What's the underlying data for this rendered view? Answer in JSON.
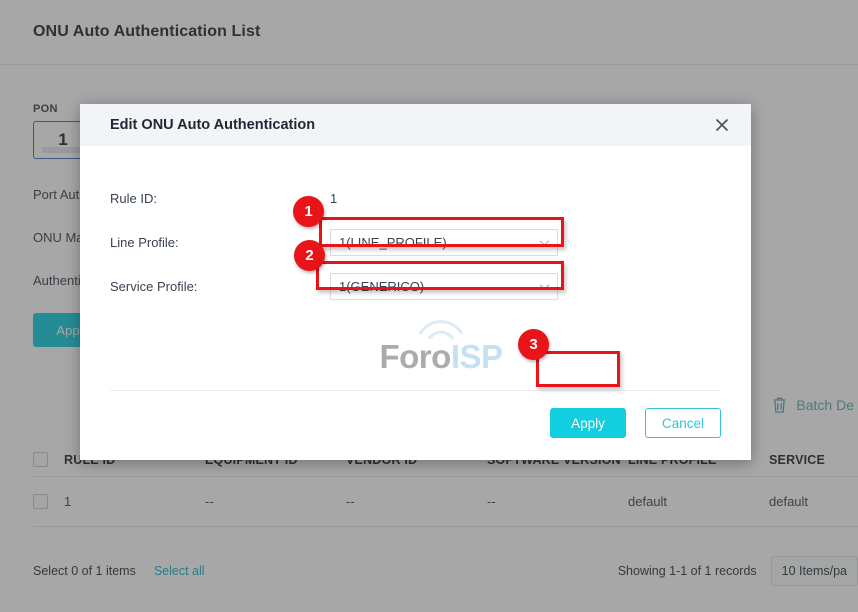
{
  "page": {
    "title": "ONU Auto Authentication List",
    "filter": {
      "pon_label": "PON",
      "pon_value": "1",
      "line_port_auth": "Port Aut",
      "line_onu_mac": "ONU Ma",
      "line_auth": "Authenti",
      "apply_label": "App"
    },
    "batch_delete_label": "Batch De",
    "table": {
      "headers": [
        "RULE ID",
        "EQUIPMENT ID",
        "VENDOR ID",
        "SOFTWARE VERSION",
        "LINE PROFILE",
        "SERVICE"
      ],
      "rows": [
        {
          "rule_id": "1",
          "equipment_id": "--",
          "vendor_id": "--",
          "software_version": "--",
          "line_profile": "default",
          "service_profile": "default"
        }
      ]
    },
    "footer": {
      "selection": "Select 0 of 1 items",
      "select_all": "Select all",
      "records": "Showing 1-1 of 1 records",
      "page_size": "10 Items/pa"
    }
  },
  "modal": {
    "title": "Edit ONU Auto Authentication",
    "close_icon": "close-icon",
    "fields": {
      "rule_id_label": "Rule ID:",
      "rule_id_value": "1",
      "line_profile_label": "Line Profile:",
      "line_profile_value": "1(LINE_PROFILE)",
      "service_profile_label": "Service Profile:",
      "service_profile_value": "1(GENERICO)"
    },
    "apply_label": "Apply",
    "cancel_label": "Cancel"
  },
  "annotations": {
    "badge_1": "1",
    "badge_2": "2",
    "badge_3": "3",
    "color": "#e8141a"
  },
  "watermark": {
    "part1": "Foro",
    "part2": "ISP"
  },
  "theme": {
    "accent": "#13cede",
    "link": "#13b3c4",
    "text": "#3a424f"
  }
}
